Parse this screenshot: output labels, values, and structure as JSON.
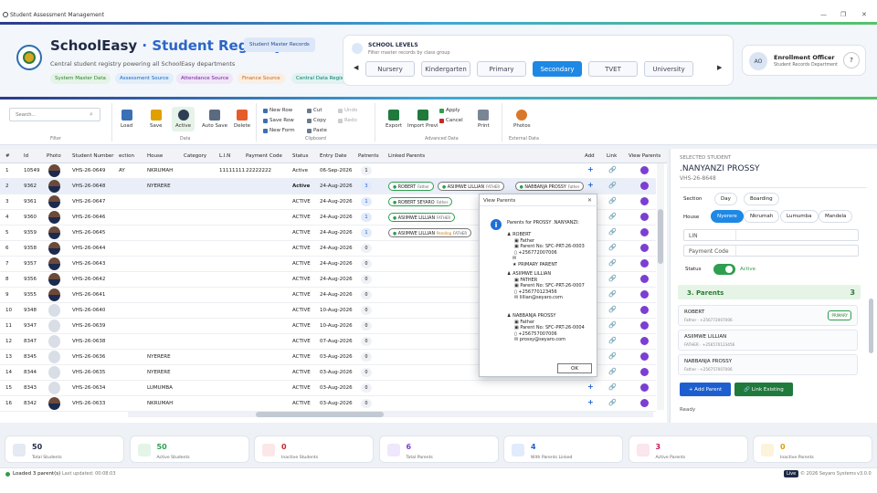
{
  "window": {
    "title": "Student Assessment Management"
  },
  "header": {
    "brand": "SchoolEasy",
    "brand_sep": " · ",
    "registry": "Student Registry",
    "badge": "Student Master Records",
    "tagline": "Central student registry powering all SchoolEasy departments",
    "chips": [
      {
        "label": "System Master Data",
        "color": "#2e7d32",
        "bg": "#e5f4e7"
      },
      {
        "label": "Assessment Source",
        "color": "#1565c0",
        "bg": "#e3eefb"
      },
      {
        "label": "Attendance Source",
        "color": "#6a1b9a",
        "bg": "#f1e6f8"
      },
      {
        "label": "Finance Source",
        "color": "#c4661f",
        "bg": "#fbefe3"
      },
      {
        "label": "Central Data Registry",
        "color": "#00796b",
        "bg": "#e0f3f1"
      }
    ]
  },
  "levels": {
    "title": "SCHOOL LEVELS",
    "subtitle": "Filter master records by class group",
    "items": [
      "Nursery",
      "Kindergarten",
      "Primary",
      "Secondary",
      "TVET",
      "University"
    ],
    "active": "Secondary"
  },
  "officer": {
    "initials": "AO",
    "name": "Enrollment Officer",
    "dept": "Student Records Department",
    "help": "?"
  },
  "search": {
    "placeholder": "Search..."
  },
  "ribbon": {
    "filter": "Filter",
    "data_group": "Data",
    "clipboard_group": "Clipboard",
    "advanced_group": "Advanced Data",
    "external_group": "External Data",
    "load": "Load",
    "save": "Save",
    "active": "Active",
    "auto_save": "Auto Save",
    "delete": "Delete",
    "new_row": "New Row",
    "save_row": "Save Row",
    "new_form": "New Form",
    "cut": "Cut",
    "copy": "Copy",
    "paste": "Paste",
    "undo": "Undo",
    "redo": "Redo",
    "export": "Export",
    "import": "Import Previ",
    "apply": "Apply",
    "cancel": "Cancel",
    "print": "Print",
    "photos": "Photos"
  },
  "grid": {
    "headers": [
      "#",
      "Id",
      "Photo",
      "Student Number",
      "ection",
      "House",
      "Category",
      "L.I.N",
      "Payment Code",
      "Status",
      "Entry Date",
      "Patrents",
      "Linked Parents",
      "Add",
      "Link",
      "View Parents"
    ],
    "rows": [
      {
        "n": "1",
        "id": "10549",
        "photo": true,
        "num": "VHS-26-0649",
        "sec": "AY",
        "house": "NKRUMAH",
        "lin": "11111111",
        "pay": "22222222",
        "status": "Active",
        "date": "06-Sep-2026",
        "count": "1",
        "blue": false,
        "parents": [],
        "sel": false,
        "plus": true
      },
      {
        "n": "2",
        "id": "9362",
        "photo": true,
        "num": "VHS-26-0648",
        "sec": "",
        "house": "NYERERE",
        "lin": "",
        "pay": "",
        "status": "Active",
        "date": "24-Aug-2026",
        "count": "3",
        "blue": true,
        "parents": [
          {
            "name": "ROBERT",
            "rel": "Father",
            "gray": false
          },
          {
            "name": "ASIIMWE LILLIAN",
            "rel": "FATHER",
            "gray": true
          },
          {
            "name": "NABBANJA PROSSY",
            "rel": "Father",
            "gray": true
          }
        ],
        "sel": true,
        "plus": true
      },
      {
        "n": "3",
        "id": "9361",
        "photo": true,
        "num": "VHS-26-0647",
        "sec": "",
        "house": "",
        "lin": "",
        "pay": "",
        "status": "ACTIVE",
        "date": "24-Aug-2026",
        "count": "1",
        "blue": true,
        "parents": [
          {
            "name": "ROBERT SEYARO",
            "rel": "Father",
            "gray": false
          }
        ],
        "sel": false,
        "plus": false
      },
      {
        "n": "4",
        "id": "9360",
        "photo": true,
        "num": "VHS-26-0646",
        "sec": "",
        "house": "",
        "lin": "",
        "pay": "",
        "status": "ACTIVE",
        "date": "24-Aug-2026",
        "count": "1",
        "blue": true,
        "parents": [
          {
            "name": "ASIIMWE LILLIAN",
            "rel": "FATHER",
            "gray": false
          }
        ],
        "sel": false,
        "plus": false
      },
      {
        "n": "5",
        "id": "9359",
        "photo": true,
        "num": "VHS-26-0645",
        "sec": "",
        "house": "",
        "lin": "",
        "pay": "",
        "status": "ACTIVE",
        "date": "24-Aug-2026",
        "count": "1",
        "blue": true,
        "parents": [
          {
            "name": "ASIIMWE LILLIAN",
            "rel": "FATHER",
            "gray": true,
            "pending": "Pending"
          }
        ],
        "sel": false,
        "plus": false
      },
      {
        "n": "6",
        "id": "9358",
        "photo": true,
        "num": "VHS-26-0644",
        "sec": "",
        "house": "",
        "lin": "",
        "pay": "",
        "status": "ACTIVE",
        "date": "24-Aug-2026",
        "count": "0",
        "blue": false,
        "parents": [],
        "sel": false,
        "plus": false
      },
      {
        "n": "7",
        "id": "9357",
        "photo": true,
        "num": "VHS-26-0643",
        "sec": "",
        "house": "",
        "lin": "",
        "pay": "",
        "status": "ACTIVE",
        "date": "24-Aug-2026",
        "count": "0",
        "blue": false,
        "parents": [],
        "sel": false,
        "plus": false
      },
      {
        "n": "8",
        "id": "9356",
        "photo": true,
        "num": "VHS-26-0642",
        "sec": "",
        "house": "",
        "lin": "",
        "pay": "",
        "status": "ACTIVE",
        "date": "24-Aug-2026",
        "count": "0",
        "blue": false,
        "parents": [],
        "sel": false,
        "plus": false
      },
      {
        "n": "9",
        "id": "9355",
        "photo": true,
        "num": "VHS-26-0641",
        "sec": "",
        "house": "",
        "lin": "",
        "pay": "",
        "status": "ACTIVE",
        "date": "24-Aug-2026",
        "count": "0",
        "blue": false,
        "parents": [],
        "sel": false,
        "plus": false
      },
      {
        "n": "10",
        "id": "9348",
        "photo": false,
        "num": "VHS-26-0640",
        "sec": "",
        "house": "",
        "lin": "",
        "pay": "",
        "status": "ACTIVE",
        "date": "10-Aug-2026",
        "count": "0",
        "blue": false,
        "parents": [],
        "sel": false,
        "plus": false
      },
      {
        "n": "11",
        "id": "9347",
        "photo": false,
        "num": "VHS-26-0639",
        "sec": "",
        "house": "",
        "lin": "",
        "pay": "",
        "status": "ACTIVE",
        "date": "10-Aug-2026",
        "count": "0",
        "blue": false,
        "parents": [],
        "sel": false,
        "plus": false
      },
      {
        "n": "12",
        "id": "8347",
        "photo": false,
        "num": "VHS-26-0638",
        "sec": "",
        "house": "",
        "lin": "",
        "pay": "",
        "status": "ACTIVE",
        "date": "07-Aug-2026",
        "count": "0",
        "blue": false,
        "parents": [],
        "sel": false,
        "plus": false
      },
      {
        "n": "13",
        "id": "8345",
        "photo": false,
        "num": "VHS-26-0636",
        "sec": "",
        "house": "NYERERE",
        "lin": "",
        "pay": "",
        "status": "ACTIVE",
        "date": "03-Aug-2026",
        "count": "0",
        "blue": false,
        "parents": [],
        "sel": false,
        "plus": false
      },
      {
        "n": "14",
        "id": "8344",
        "photo": false,
        "num": "VHS-26-0635",
        "sec": "",
        "house": "NYERERE",
        "lin": "",
        "pay": "",
        "status": "ACTIVE",
        "date": "03-Aug-2026",
        "count": "0",
        "blue": false,
        "parents": [],
        "sel": false,
        "plus": false
      },
      {
        "n": "15",
        "id": "8343",
        "photo": false,
        "num": "VHS-26-0634",
        "sec": "",
        "house": "LUMUMBA",
        "lin": "",
        "pay": "",
        "status": "ACTIVE",
        "date": "03-Aug-2026",
        "count": "0",
        "blue": false,
        "parents": [],
        "sel": false,
        "plus": true
      },
      {
        "n": "16",
        "id": "8342",
        "photo": true,
        "num": "VHS-26-0633",
        "sec": "",
        "house": "NKRUMAH",
        "lin": "",
        "pay": "",
        "status": "ACTIVE",
        "date": "03-Aug-2026",
        "count": "0",
        "blue": false,
        "parents": [],
        "sel": false,
        "plus": true
      }
    ]
  },
  "side": {
    "title": "SELECTED STUDENT",
    "name": ".NANYANZI PROSSY",
    "number": "VHS-26-8648",
    "section_label": "Section",
    "sections": [
      "Day",
      "Boarding"
    ],
    "house_label": "House",
    "houses": [
      "Nyerere",
      "Nkrumah",
      "Lumumba",
      "Mandela"
    ],
    "house_active": "Nyerere",
    "lin_label": "LIN",
    "pay_label": "Payment Code",
    "status_label": "Status",
    "status_value": "Active",
    "parents_title": "3.  Parents",
    "parents_count": "3",
    "parents": [
      {
        "name": "ROBERT",
        "meta": "Father · +256772007006",
        "primary": "PRIMARY"
      },
      {
        "name": "ASIIMWE LILLIAN",
        "meta": "FATHER · +256570123456",
        "primary": ""
      },
      {
        "name": "NABBANJA PROSSY",
        "meta": "Father · +256757007006",
        "primary": ""
      }
    ],
    "add_parent": "+ Add Parent",
    "link_existing": "Link Existing",
    "ready": "Ready"
  },
  "dialog": {
    "title": "View Parents",
    "close": "✕",
    "heading": "Parents for PROSSY .NANYANZI:",
    "p1": [
      "ROBERT",
      "Father",
      "Parent No: SFC-PRT-26-0003",
      "+256772007006",
      "✉",
      "★ PRIMARY PARENT"
    ],
    "p2": [
      "ASIIMWE LILLIAN",
      "FATHER",
      "Parent No: SFC-PRT-26-0007",
      "+256770123456",
      "lillian@seyaro.com"
    ],
    "p3": [
      "NABBANJA PROSSY",
      "Father",
      "Parent No: SFC-PRT-26-0004",
      "+256757007006",
      "prossy@seyaro.com"
    ],
    "ok": "OK"
  },
  "stats": [
    {
      "value": "50",
      "label": "Total Students",
      "color": "#1f2a44",
      "bg": "#e4e9f2"
    },
    {
      "value": "50",
      "label": "Active Students",
      "color": "#2e9e4f",
      "bg": "#e4f5e8"
    },
    {
      "value": "0",
      "label": "Inactive Students",
      "color": "#c62828",
      "bg": "#fbe7e7"
    },
    {
      "value": "6",
      "label": "Total Parents",
      "color": "#7b3fd1",
      "bg": "#efe7fb"
    },
    {
      "value": "4",
      "label": "With Parents Linked",
      "color": "#1e5fcf",
      "bg": "#e1ebfb"
    },
    {
      "value": "3",
      "label": "Active Parents",
      "color": "#c2185b",
      "bg": "#fbe5ee"
    },
    {
      "value": "0",
      "label": "Inactive Parents",
      "color": "#e0a000",
      "bg": "#fcf3dc"
    }
  ],
  "status": {
    "loaded": "Loaded 3 parent(s)",
    "updated": "Last updated: 00:08:03",
    "live": "Live",
    "copyright": "© 2026 Seyaro Systems",
    "version": "v3.0.0"
  }
}
